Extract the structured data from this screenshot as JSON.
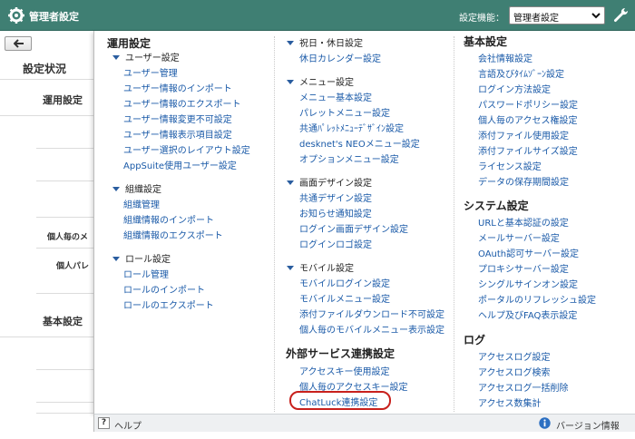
{
  "header": {
    "title": "管理者設定",
    "function_label": "設定機能：",
    "function_selected": "管理者設定",
    "accent": "#3f7f73"
  },
  "background": {
    "heading": "設定状況",
    "rows": [
      {
        "label": "運用設定",
        "kind": "s"
      },
      {
        "label": "個人毎のメ",
        "kind": "t"
      },
      {
        "label": "個人パレ",
        "kind": "t"
      },
      {
        "label": "基本設定",
        "kind": "s"
      }
    ]
  },
  "menu": {
    "col1": {
      "title": "運用設定",
      "groups": [
        {
          "label": "ユーザー設定",
          "links": [
            "ユーザー管理",
            "ユーザー情報のインポート",
            "ユーザー情報のエクスポート",
            "ユーザー情報変更不可設定",
            "ユーザー情報表示項目設定",
            "ユーザー選択のレイアウト設定",
            "AppSuite使用ユーザー設定"
          ]
        },
        {
          "label": "組織設定",
          "links": [
            "組織管理",
            "組織情報のインポート",
            "組織情報のエクスポート"
          ]
        },
        {
          "label": "ロール設定",
          "links": [
            "ロール管理",
            "ロールのインポート",
            "ロールのエクスポート"
          ]
        }
      ]
    },
    "col2": {
      "groups": [
        {
          "label": "祝日・休日設定",
          "links": [
            "休日カレンダー設定"
          ]
        },
        {
          "label": "メニュー設定",
          "links": [
            "メニュー基本設定",
            "パレットメニュー設定",
            "共通ﾊﾟﾚｯﾄﾒﾆｭｰﾃﾞｻﾞｲﾝ設定",
            "desknet's NEOメニュー設定",
            "オプションメニュー設定"
          ]
        },
        {
          "label": "画面デザイン設定",
          "links": [
            "共通デザイン設定",
            "お知らせ通知設定",
            "ログイン画面デザイン設定",
            "ログインロゴ設定"
          ]
        },
        {
          "label": "モバイル設定",
          "links": [
            "モバイルログイン設定",
            "モバイルメニュー設定",
            "添付ファイルダウンロード不可設定",
            "個人毎のモバイルメニュー表示設定"
          ]
        }
      ],
      "external": {
        "title": "外部サービス連携設定",
        "links": [
          "アクセスキー使用設定",
          "個人毎のアクセスキー設定",
          "ChatLuck連携設定"
        ]
      }
    },
    "col3": {
      "sections": [
        {
          "title": "基本設定",
          "links": [
            "会社情報設定",
            "言語及びﾀｲﾑｿﾞｰﾝ設定",
            "ログイン方法設定",
            "パスワードポリシー設定",
            "個人毎のアクセス権設定",
            "添付ファイル使用設定",
            "添付ファイルサイズ設定",
            "ライセンス設定",
            "データの保存期間設定"
          ]
        },
        {
          "title": "システム設定",
          "links": [
            "URLと基本認証の設定",
            "メールサーバー設定",
            "OAuth認可サーバー設定",
            "プロキシサーバー設定",
            "シングルサインオン設定",
            "ポータルのリフレッシュ設定",
            "ヘルプ及びFAQ表示設定"
          ]
        },
        {
          "title": "ログ",
          "links": [
            "アクセスログ設定",
            "アクセスログ検索",
            "アクセスログ一括削除",
            "アクセス数集計"
          ]
        }
      ]
    }
  },
  "footer": {
    "help_mark": "?",
    "help": "ヘルプ",
    "version": "バージョン情報"
  },
  "colors": {
    "link": "#1a5aa8",
    "highlight_ring": "#c8201c",
    "triangle": "#2a5d9f"
  }
}
